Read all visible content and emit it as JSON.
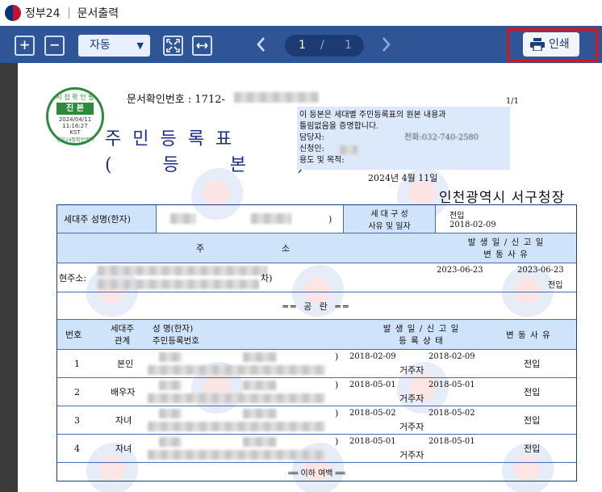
{
  "titlebar": {
    "app_title": "정부24",
    "separator": "|",
    "doc_title": "문서출력"
  },
  "toolbar": {
    "zoom_in": "+",
    "zoom_out": "−",
    "zoom_value": "자동",
    "page_current": "1",
    "page_slash": "/",
    "page_total": "1",
    "prev_icon": "chevron-left-icon",
    "next_icon": "chevron-right-icon",
    "print_label": "인쇄",
    "accent": "#2f5596",
    "highlight": "#d9151c"
  },
  "document": {
    "stamp": {
      "top": "시 접 확 인 필",
      "mid": "진 본",
      "date": "2024/04/11",
      "time": "11:16:27",
      "kst": "KST",
      "bottom": "정부24접확인센터"
    },
    "confirm_label": "문서확인번호 : 1712-",
    "title_line1": "주민등록표",
    "title_line2": "( 등 본 )",
    "page_count": "1/1",
    "notice": {
      "line1": "이 등본은 세대별 주민등록표의 원본 내용과",
      "line2": "틀림없음을 증명합니다.",
      "line3": "담당자:",
      "line3_right": "전화:032-740-2580",
      "line4": "신청인:",
      "line5": "용도 및 목적:"
    },
    "issue_date": "2024년 4월 11일",
    "issuer": "인천광역시 서구청장",
    "household": {
      "head_label": "세대주 성명(한자)",
      "head_close": ")",
      "composition_label": "세 대 구 성",
      "composition_label2": "사유 및 일자",
      "composition_reason": "전입",
      "composition_date": "2018-02-09"
    },
    "address_header": {
      "col1": "주",
      "col2": "소",
      "col3a": "발 생 일 / 신 고 일",
      "col3b": "변 동 사 유"
    },
    "current_address": {
      "label": "현주소:",
      "suffix": "차)",
      "occur": "2023-06-23",
      "report": "2023-06-23",
      "reason": "전입"
    },
    "blank_note": "══ 공 란 ══",
    "members_header": {
      "no": "번호",
      "rel1": "세대주",
      "rel2": "관계",
      "name1": "성 명(한자)",
      "name2": "주민등록번호",
      "date1": "발 생 일 / 신 고 일",
      "date2": "등 록 상 태",
      "change": "변 동 사 유"
    },
    "members": [
      {
        "no": "1",
        "relation": "본인",
        "occur": "2018-02-09",
        "report": "2018-02-09",
        "status": "거주자",
        "reason": "전입"
      },
      {
        "no": "2",
        "relation": "배우자",
        "occur": "2018-05-01",
        "report": "2018-05-01",
        "status": "거주자",
        "reason": "전입"
      },
      {
        "no": "3",
        "relation": "자녀",
        "occur": "2018-05-02",
        "report": "2018-05-02",
        "status": "거주자",
        "reason": "전입"
      },
      {
        "no": "4",
        "relation": "자녀",
        "occur": "2018-05-01",
        "report": "2018-05-01",
        "status": "거주자",
        "reason": "전입"
      }
    ],
    "end_note": "══ 이하 여백 ══"
  }
}
